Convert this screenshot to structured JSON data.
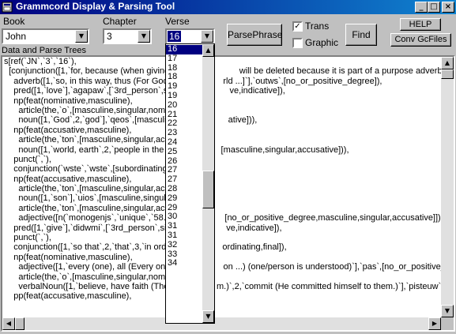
{
  "window": {
    "title": "Grammcord Display & Parsing Tool",
    "min_symbol": "_",
    "max_symbol": "□",
    "close_symbol": "×"
  },
  "labels": {
    "book": "Book",
    "chapter": "Chapter",
    "verse": "Verse",
    "data_and_parse_trees": "Data and Parse Trees"
  },
  "book_select": {
    "value": "John"
  },
  "chapter_select": {
    "value": "3"
  },
  "verse_select": {
    "value": "16"
  },
  "buttons": {
    "parse_phrase": "ParsePhrase",
    "find": "Find",
    "help": "HELP",
    "conv_gc_files": "Conv GcFiles"
  },
  "checkboxes": {
    "trans": {
      "label": "Trans",
      "checked": true
    },
    "graphic": {
      "label": "Graphic",
      "checked": false
    }
  },
  "verse_dropdown_options": [
    "16",
    "17",
    "18",
    "18",
    "19",
    "19",
    "20",
    "21",
    "22",
    "23",
    "24",
    "25",
    "26",
    "27",
    "27",
    "28",
    "29",
    "29",
    "30",
    "31",
    "31",
    "32",
    "33",
    "34"
  ],
  "text_lines": [
    "s[ref(`JN`,`3`,`16`),",
    "  [conjunction([1,`for, because (when giving a                          will be deleted because it is part of a purpose adverbial clau",
    "    adverb([1,`so, in this way, thus (For God so                  rld ...]`],`outws`,[no_or_positive_degree]),",
    "    pred([1,`love`],`agapaw`,[`3rd_person`,singul                  ve,indicative]),",
    "    np(feat(nominative,masculine),",
    "      article(the,`o`,[masculine,singular,nominati",
    "      noun([1,`God`,2,`god`],`qeos`,[masculine,si                  ative])),",
    "    np(feat(accusative,masculine),",
    "      article(the,`ton`,[masculine,singular,accusa",
    "      noun([1,`world, earth`,2,`people in the wo                  [masculine,singular,accusative])),",
    "    punct(`,`),",
    "    conjunction(`wste`,`wste`,[subordinating,re",
    "    np(feat(accusative,masculine),",
    "      article(the,`ton`,[masculine,singular,accus",
    "      noun([1,`son`],`uios`,[masculine,singular,a",
    "      article(the,`ton`,[masculine,singular,accus",
    "      adjective([n(`monogenjs`,`unique`,`58.52`)                  [no_or_positive_degree,masculine,singular,accusative]]),",
    "    pred([1,`give`],`didwmi`,[`3rd_person`,singul                  ve,indicative]),",
    "    punct(`,`),",
    "    conjunction([1,`so that`,2,`that`,3,`in order t                  ordinating,final]),",
    "    np(feat(nominative,masculine),",
    "      adjective([1,`every (one), all (Every one th                  on ...) (one/person is understood)`],`pas`,[no_or_positive_deg",
    "      article(the,`o`,[masculine,singular,nominat",
    "      verbalNoun([1,`believe, have faith (They                  m.)`,2,`commit (He committed himself to them.)`],`pisteuw`,[no_",
    "    pp(feat(accusative,masculine),"
  ],
  "colors": {
    "titlebar_start": "#000080",
    "titlebar_end": "#1084d0",
    "face": "#c0c0c0",
    "selection": "#000080"
  }
}
